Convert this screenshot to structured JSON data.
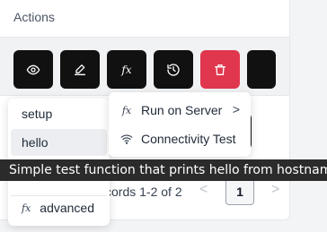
{
  "header": {
    "title": "Actions"
  },
  "toolbar": {
    "buttons": [
      {
        "icon": "eye-icon",
        "color": "#111111"
      },
      {
        "icon": "edit-icon",
        "color": "#111111"
      },
      {
        "icon": "function-icon",
        "label": "fx",
        "color": "#111111"
      },
      {
        "icon": "history-icon",
        "color": "#111111"
      },
      {
        "icon": "trash-icon",
        "color": "#e0374f"
      }
    ]
  },
  "dropdown": {
    "items": [
      {
        "label": "setup"
      },
      {
        "label": "hello",
        "active": true
      },
      {
        "label": "advanced",
        "icon": "function-icon",
        "icon_label": "fx"
      }
    ]
  },
  "submenu": {
    "items": [
      {
        "label": "Run on Server",
        "icon": "function-icon",
        "icon_label": "fx",
        "chevron": ">"
      },
      {
        "label": "Connectivity Test",
        "icon": "wifi-icon"
      }
    ]
  },
  "tooltip": {
    "text": "Simple test function that prints hello from hostname"
  },
  "pagination": {
    "records_text": "cords 1-2 of 2",
    "prev": "<",
    "page": "1",
    "next": ">"
  }
}
